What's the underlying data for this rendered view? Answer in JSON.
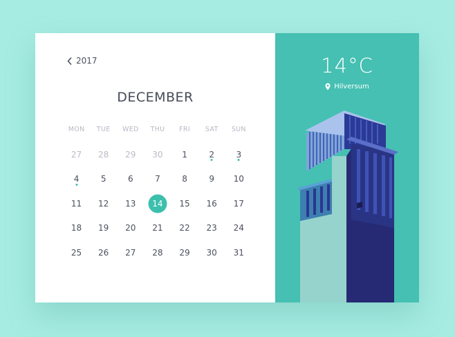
{
  "calendar": {
    "year_label": "2017",
    "month_label": "DECEMBER",
    "weekdays": [
      "MON",
      "TUE",
      "WED",
      "THU",
      "FRI",
      "SAT",
      "SUN"
    ],
    "weeks": [
      [
        {
          "d": "27",
          "muted": true
        },
        {
          "d": "28",
          "muted": true
        },
        {
          "d": "29",
          "muted": true
        },
        {
          "d": "30",
          "muted": true
        },
        {
          "d": "1"
        },
        {
          "d": "2",
          "event": true
        },
        {
          "d": "3",
          "event": true
        }
      ],
      [
        {
          "d": "4",
          "event": true
        },
        {
          "d": "5"
        },
        {
          "d": "6"
        },
        {
          "d": "7"
        },
        {
          "d": "8"
        },
        {
          "d": "9"
        },
        {
          "d": "10"
        }
      ],
      [
        {
          "d": "11"
        },
        {
          "d": "12"
        },
        {
          "d": "13"
        },
        {
          "d": "14",
          "selected": true
        },
        {
          "d": "15"
        },
        {
          "d": "16"
        },
        {
          "d": "17"
        }
      ],
      [
        {
          "d": "18"
        },
        {
          "d": "19"
        },
        {
          "d": "20"
        },
        {
          "d": "21"
        },
        {
          "d": "22"
        },
        {
          "d": "23"
        },
        {
          "d": "24"
        }
      ],
      [
        {
          "d": "25"
        },
        {
          "d": "26"
        },
        {
          "d": "27"
        },
        {
          "d": "28"
        },
        {
          "d": "29"
        },
        {
          "d": "30"
        },
        {
          "d": "31"
        }
      ]
    ]
  },
  "weather": {
    "temperature": "14°C",
    "location": "Hilversum"
  },
  "colors": {
    "accent": "#3dbfad",
    "panel": "#45c0b2",
    "background": "#a6ece2",
    "building_dark": "#262a74",
    "building_mid": "#3a4ca8",
    "building_light": "#97d3cd"
  },
  "icons": {
    "back": "chevron-left-icon",
    "location": "map-pin-icon"
  }
}
